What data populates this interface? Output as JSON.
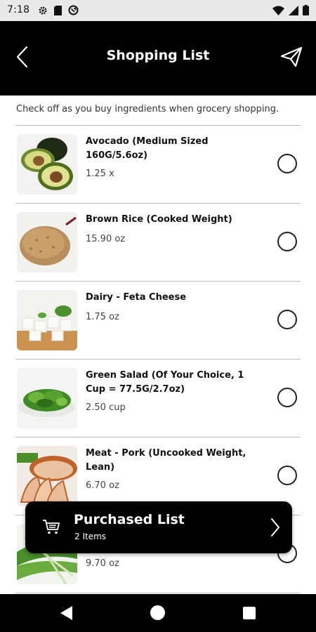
{
  "status_bar": {
    "time": "7:18",
    "left_icons": [
      "gear-icon",
      "sim-card-icon",
      "data-saver-icon"
    ],
    "right_icons": [
      "wifi-icon",
      "signal-icon",
      "battery-icon"
    ]
  },
  "header": {
    "title": "Shopping List",
    "back_icon": "chevron-left-icon",
    "share_icon": "paper-plane-icon"
  },
  "instructions": "Check off as you buy ingredients when grocery shopping.",
  "items": [
    {
      "name": "Avocado (Medium Sized 160G/5.6oz)",
      "qty": "1.25 x",
      "checked": false
    },
    {
      "name": "Brown Rice (Cooked Weight)",
      "qty": "15.90 oz",
      "checked": false
    },
    {
      "name": "Dairy - Feta Cheese",
      "qty": "1.75 oz",
      "checked": false
    },
    {
      "name": "Green Salad (Of Your Choice, 1 Cup = 77.5G/2.7oz)",
      "qty": "2.50 cup",
      "checked": false
    },
    {
      "name": "Meat - Pork (Uncooked Weight, Lean)",
      "qty": "6.70 oz",
      "checked": false
    },
    {
      "name": "",
      "qty": "9.70 oz",
      "checked": false
    }
  ],
  "purchased": {
    "title": "Purchased List",
    "count": "2 Items"
  },
  "colors": {
    "header_bg": "#000000",
    "status_bg": "#e9e9e9",
    "divider": "#bdbdbd"
  }
}
